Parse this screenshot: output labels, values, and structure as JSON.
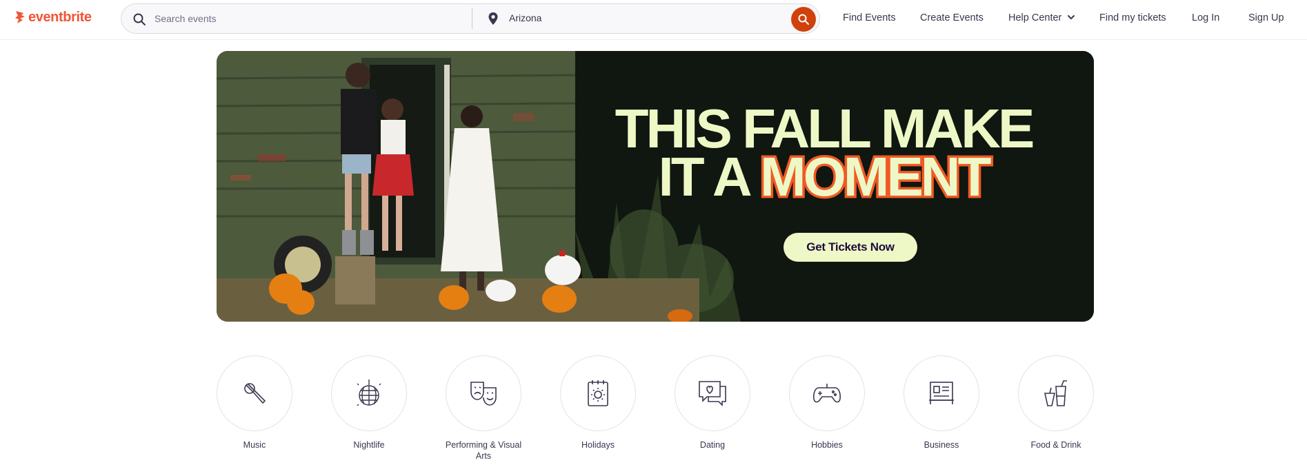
{
  "header": {
    "logo_text": "eventbrite",
    "brand_color": "#f05537",
    "search": {
      "placeholder": "Search events",
      "location_value": "Arizona",
      "submit_color": "#d1410c"
    },
    "nav": [
      {
        "label": "Find Events"
      },
      {
        "label": "Create Events"
      },
      {
        "label": "Help Center",
        "icon": "chevron-down-icon"
      },
      {
        "label": "Find my tickets"
      },
      {
        "label": "Log In"
      },
      {
        "label": "Sign Up"
      }
    ]
  },
  "hero": {
    "title_line1": "THIS FALL MAKE",
    "title_line2_prefix": "IT A ",
    "title_highlight": "MOMENT",
    "cta_label": "Get Tickets Now",
    "text_color": "#eef8c6",
    "highlight_color": "#f05a24"
  },
  "categories": [
    {
      "label": "Music",
      "icon": "microphone-icon"
    },
    {
      "label": "Nightlife",
      "icon": "disco-ball-icon"
    },
    {
      "label": "Performing & Visual Arts",
      "icon": "theater-masks-icon"
    },
    {
      "label": "Holidays",
      "icon": "calendar-sun-icon"
    },
    {
      "label": "Dating",
      "icon": "chat-heart-icon"
    },
    {
      "label": "Hobbies",
      "icon": "gamepad-icon"
    },
    {
      "label": "Business",
      "icon": "presentation-board-icon"
    },
    {
      "label": "Food & Drink",
      "icon": "drinks-icon"
    }
  ]
}
